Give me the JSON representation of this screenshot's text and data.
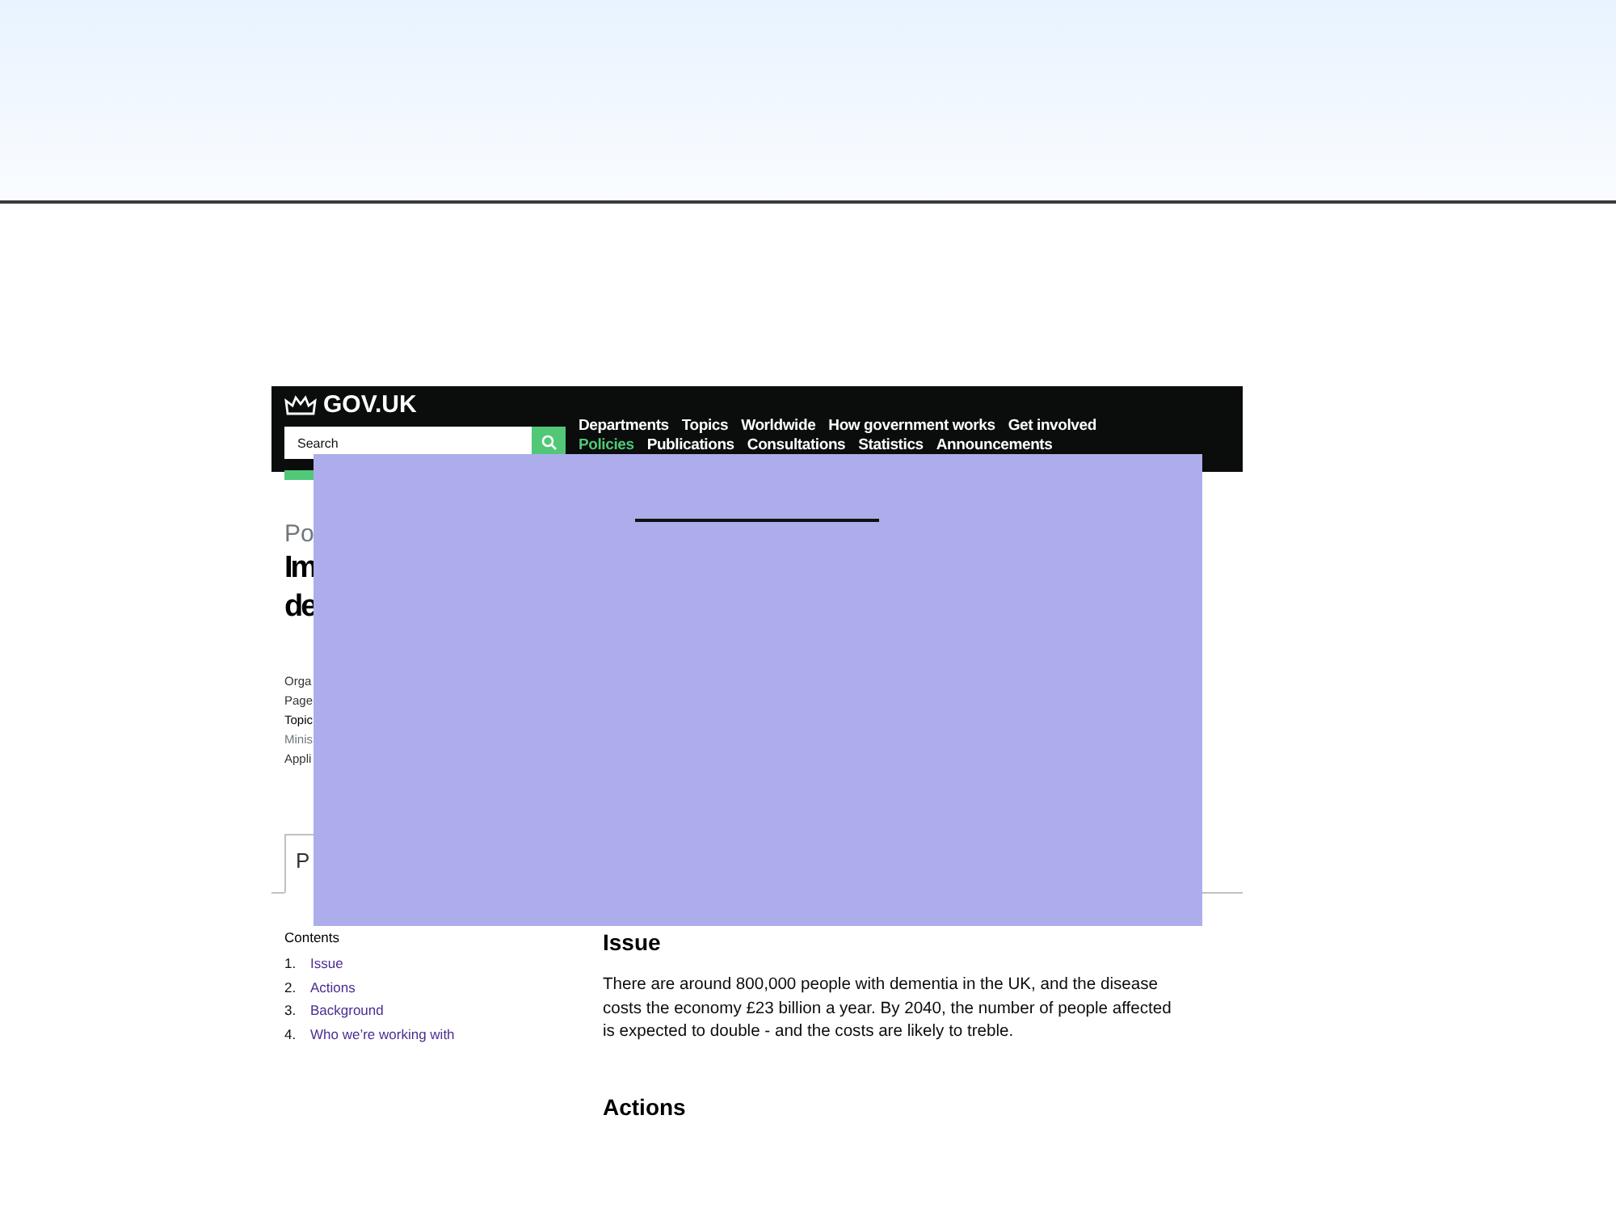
{
  "header": {
    "logo": "GOV.UK",
    "search": {
      "placeholder": "Search"
    },
    "nav": [
      {
        "label": "Departments",
        "selected": false
      },
      {
        "label": "Topics",
        "selected": false
      },
      {
        "label": "Worldwide",
        "selected": false
      },
      {
        "label": "How government works",
        "selected": false
      },
      {
        "label": "Get involved",
        "selected": false
      }
    ],
    "subnav": [
      {
        "label": "Policies",
        "selected": true
      },
      {
        "label": "Publications",
        "selected": false
      },
      {
        "label": "Consultations",
        "selected": false
      },
      {
        "label": "Statistics",
        "selected": false
      },
      {
        "label": "Announcements",
        "selected": false
      }
    ]
  },
  "page": {
    "kicker": "Po",
    "title_lines": [
      "Im",
      "de"
    ],
    "metadata": [
      {
        "text": "Orga",
        "kind": "plain"
      },
      {
        "text": "Page",
        "kind": "plain"
      },
      {
        "text": "Topic",
        "kind": "strong"
      },
      {
        "text": "Minis",
        "kind": "muted"
      },
      {
        "text": "Appli",
        "kind": "plain"
      }
    ],
    "tab": "P"
  },
  "contents": {
    "heading": "Contents",
    "items": [
      {
        "number": "1.",
        "label": "Issue"
      },
      {
        "number": "2.",
        "label": "Actions"
      },
      {
        "number": "3.",
        "label": "Background"
      },
      {
        "number": "4.",
        "label": "Who we’re working with"
      }
    ]
  },
  "sections": [
    {
      "heading": "Issue",
      "body": "There are around 800,000 people with dementia in the UK, and the disease costs the economy £23 billion a year. By 2040, the number of people affected is expected to double - and the costs are likely to treble."
    },
    {
      "heading": "Actions"
    }
  ]
}
